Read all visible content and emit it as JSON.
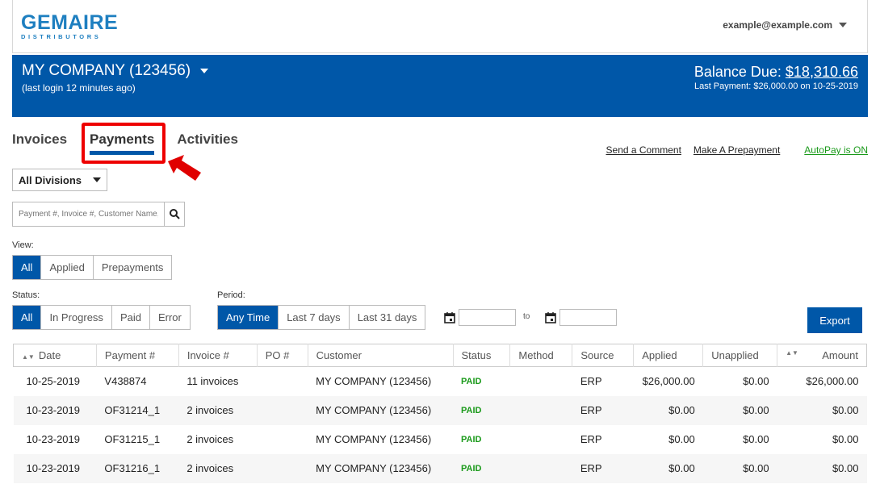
{
  "header": {
    "logo_main": "GEMAIRE",
    "logo_sub": "DISTRIBUTORS",
    "user_email": "example@example.com"
  },
  "banner": {
    "company": "MY COMPANY (123456)",
    "last_login": "(last login 12 minutes ago)",
    "balance_label": "Balance Due:",
    "balance_amount": "$18,310.66",
    "last_payment": "Last Payment: $26,000.00 on 10-25-2019"
  },
  "tabs": [
    {
      "label": "Invoices",
      "active": false
    },
    {
      "label": "Payments",
      "active": true
    },
    {
      "label": "Activities",
      "active": false
    }
  ],
  "actions": {
    "send_comment": "Send a Comment",
    "prepayment": "Make A Prepayment",
    "autopay": "AutoPay is ON"
  },
  "filters": {
    "division": "All Divisions",
    "search_placeholder": "Payment #, Invoice #, Customer Name, C",
    "view_label": "View:",
    "view_options": [
      "All",
      "Applied",
      "Prepayments"
    ],
    "status_label": "Status:",
    "status_options": [
      "All",
      "In Progress",
      "Paid",
      "Error"
    ],
    "period_label": "Period:",
    "period_options": [
      "Any Time",
      "Last 7 days",
      "Last 31 days"
    ],
    "to_label": "to",
    "export_label": "Export"
  },
  "table": {
    "columns": [
      "Date",
      "Payment #",
      "Invoice #",
      "PO #",
      "Customer",
      "Status",
      "Method",
      "Source",
      "Applied",
      "Unapplied",
      "Amount"
    ],
    "rows": [
      [
        "10-25-2019",
        "V438874",
        "11 invoices",
        "",
        "MY COMPANY (123456)",
        "PAID",
        "",
        "ERP",
        "$26,000.00",
        "$0.00",
        "$26,000.00"
      ],
      [
        "10-23-2019",
        "OF31214_1",
        "2 invoices",
        "",
        "MY COMPANY (123456)",
        "PAID",
        "",
        "ERP",
        "$0.00",
        "$0.00",
        "$0.00"
      ],
      [
        "10-23-2019",
        "OF31215_1",
        "2 invoices",
        "",
        "MY COMPANY (123456)",
        "PAID",
        "",
        "ERP",
        "$0.00",
        "$0.00",
        "$0.00"
      ],
      [
        "10-23-2019",
        "OF31216_1",
        "2 invoices",
        "",
        "MY COMPANY (123456)",
        "PAID",
        "",
        "ERP",
        "$0.00",
        "$0.00",
        "$0.00"
      ]
    ]
  },
  "colors": {
    "brand_blue": "#0057a8",
    "highlight_red": "#e00000",
    "paid_green": "#1a9a1a"
  }
}
